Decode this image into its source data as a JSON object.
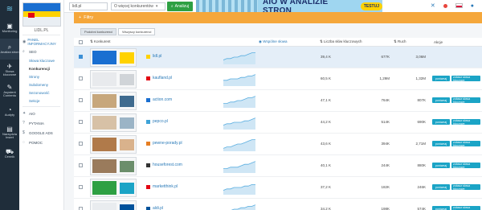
{
  "rail": [
    {
      "icon": "home-icon",
      "glyph": "≋",
      "label": ""
    },
    {
      "icon": "monitoring-icon",
      "glyph": "▣",
      "label": "Monitoring"
    },
    {
      "icon": "search-icon",
      "glyph": "⌕",
      "label": "Analiza stron"
    },
    {
      "icon": "keywords-icon",
      "glyph": "✈",
      "label": "Słowa kluczowe"
    },
    {
      "icon": "pencil-icon",
      "glyph": "✎",
      "label": "Asystent Contentu"
    },
    {
      "icon": "activity-icon",
      "glyph": "◔",
      "label": "Audyty"
    },
    {
      "icon": "book-icon",
      "glyph": "▤",
      "label": "Narzędzia Insert"
    },
    {
      "icon": "cart-icon",
      "glyph": "⛟",
      "label": "Cennik"
    }
  ],
  "sidebar": {
    "domain": "LIDL.PL",
    "sections": [
      {
        "label": "PANEL INFORMACYJNY",
        "icon": "info-icon",
        "glyph": "◉",
        "blue": true
      },
      {
        "label": "SEO",
        "icon": "seo-icon",
        "glyph": "⌕",
        "blue": false
      }
    ],
    "seo_items": [
      {
        "label": "Słowa kluczowe",
        "current": false
      },
      {
        "label": "Konkurencji",
        "current": true
      },
      {
        "label": "Strony",
        "current": false
      },
      {
        "label": "Subdomeny",
        "current": false
      },
      {
        "label": "Sezonowość",
        "current": false
      },
      {
        "label": "Sekcje",
        "current": false
      }
    ],
    "collapsed": [
      {
        "label": "AIO",
        "glyph": "✦"
      },
      {
        "label": "PYTANIA",
        "glyph": "?"
      },
      {
        "label": "GOOGLE ADS",
        "glyph": "$"
      },
      {
        "label": "POMOC",
        "glyph": "◌"
      }
    ]
  },
  "topbar": {
    "search_value": "lidl.pl",
    "dropdown_value": "O więcej konkurentów",
    "analyze_label": "Analizuj",
    "banner_text": "AIO W ANALIZIE STRON",
    "banner_cta": "TESTUJ"
  },
  "filters": {
    "label": "Filtry"
  },
  "tabs": [
    {
      "label": "Podobni konkurenci",
      "active": true
    },
    {
      "label": "Wszyscy konkurenci",
      "active": false
    }
  ],
  "table": {
    "headers": {
      "competitor": "Konkurent",
      "common": "Wspólne słowa",
      "keywords": "Liczba słów kluczowych",
      "traffic": "Ruch",
      "actions": "Akcje"
    },
    "compare_label": "porównaj",
    "show_label": "zobacz słowa kluczowe",
    "colors": {
      "accent": "#2a7ab8",
      "pill": "#1ba4c6",
      "filter": "#f5a73b",
      "green": "#2ea043"
    },
    "rows": [
      {
        "domain": "lidl.pl",
        "common": "39,4 K",
        "keywords": "677K",
        "traffic": "3,06M",
        "selected": true,
        "checked": true,
        "fav": "#ffd200",
        "thumb_a": "#1a6fd1",
        "thumb_b": "#ffd200",
        "spark": [
          3,
          4,
          4,
          5,
          5,
          6,
          6,
          7,
          8,
          8
        ],
        "show_actions": false
      },
      {
        "domain": "kaufland.pl",
        "common": "60,5 K",
        "keywords": "1,29M",
        "traffic": "1,32M",
        "selected": false,
        "checked": false,
        "fav": "#e30613",
        "thumb_a": "#e8eaed",
        "thumb_b": "#d0d4d8",
        "spark": [
          4,
          4,
          5,
          5,
          5,
          6,
          6,
          7,
          7,
          8
        ],
        "show_actions": true
      },
      {
        "domain": "action.com",
        "common": "47,1 K",
        "keywords": "764K",
        "traffic": "807K",
        "selected": false,
        "checked": false,
        "fav": "#1a6fd1",
        "thumb_a": "#c7a77c",
        "thumb_b": "#3f6b8f",
        "spark": [
          3,
          3,
          4,
          4,
          5,
          5,
          6,
          7,
          7,
          8
        ],
        "show_actions": true
      },
      {
        "domain": "pepco.pl",
        "common": "44,2 K",
        "keywords": "514K",
        "traffic": "690K",
        "selected": false,
        "checked": false,
        "fav": "#3ea3d8",
        "thumb_a": "#d7c1a6",
        "thumb_b": "#9bb4c6",
        "spark": [
          3,
          4,
          4,
          5,
          5,
          5,
          6,
          6,
          7,
          8
        ],
        "show_actions": true
      },
      {
        "domain": "pewne-porady.pl",
        "common": "43,6 K",
        "keywords": "394K",
        "traffic": "2,71M",
        "selected": false,
        "checked": false,
        "fav": "#e67e22",
        "thumb_a": "#b07a4a",
        "thumb_b": "#d9b28c",
        "spark": [
          2,
          3,
          3,
          4,
          5,
          5,
          6,
          7,
          8,
          8
        ],
        "show_actions": true
      },
      {
        "domain": "houseforest.com",
        "common": "40,1 K",
        "keywords": "244K",
        "traffic": "880K",
        "selected": false,
        "checked": false,
        "fav": "#333333",
        "thumb_a": "#9a7b5c",
        "thumb_b": "#6b8e6b",
        "spark": [
          3,
          3,
          4,
          4,
          4,
          5,
          6,
          6,
          7,
          8
        ],
        "show_actions": true
      },
      {
        "domain": "marketthink.pl",
        "common": "37,2 K",
        "keywords": "182K",
        "traffic": "246K",
        "selected": false,
        "checked": false,
        "fav": "#e30613",
        "thumb_a": "#2ea043",
        "thumb_b": "#1ba4c6",
        "spark": [
          3,
          4,
          4,
          5,
          5,
          5,
          6,
          6,
          7,
          7
        ],
        "show_actions": true
      },
      {
        "domain": "aldi.pl",
        "common": "34,2 K",
        "keywords": "198K",
        "traffic": "574K",
        "selected": false,
        "checked": false,
        "fav": "#00529b",
        "thumb_a": "#e9ecef",
        "thumb_b": "#00529b",
        "spark": [
          3,
          3,
          4,
          5,
          5,
          6,
          6,
          7,
          7,
          8
        ],
        "show_actions": true
      }
    ]
  }
}
